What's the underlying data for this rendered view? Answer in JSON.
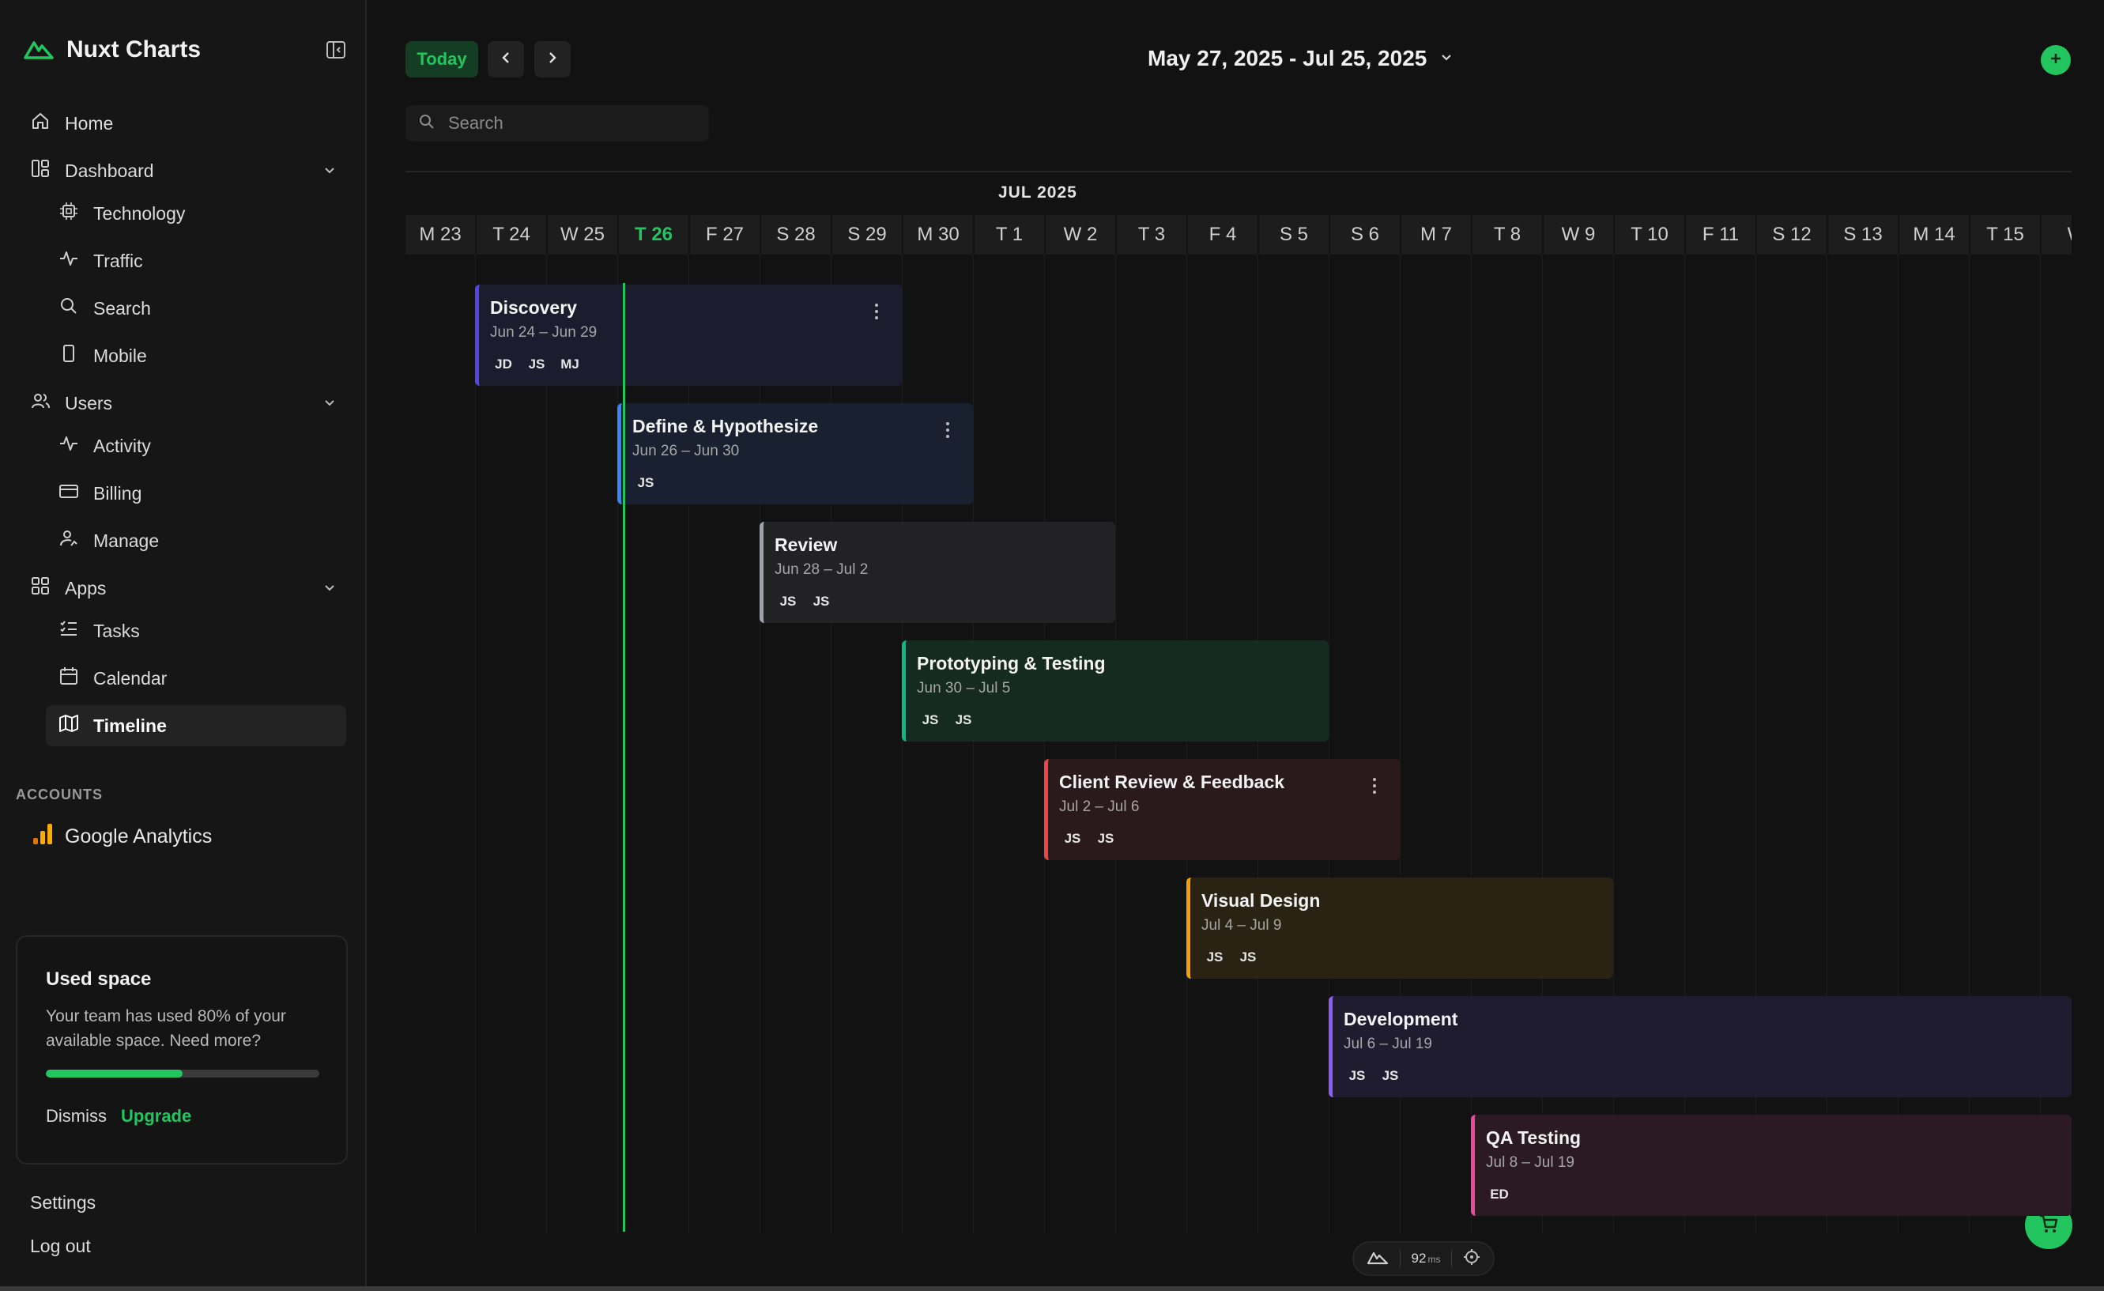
{
  "app": {
    "name": "Nuxt Charts"
  },
  "nav": {
    "home": "Home",
    "dashboard": "Dashboard",
    "technology": "Technology",
    "traffic": "Traffic",
    "search": "Search",
    "mobile": "Mobile",
    "users": "Users",
    "activity": "Activity",
    "billing": "Billing",
    "manage": "Manage",
    "apps": "Apps",
    "tasks": "Tasks",
    "calendar": "Calendar",
    "timeline": "Timeline"
  },
  "accounts": {
    "label": "ACCOUNTS",
    "google_analytics": "Google Analytics"
  },
  "used_space": {
    "title": "Used space",
    "text": "Your team has used 80% of your available space. Need more?",
    "percent": 50,
    "dismiss": "Dismiss",
    "upgrade": "Upgrade"
  },
  "footer": {
    "settings": "Settings",
    "logout": "Log out"
  },
  "toolbar": {
    "today": "Today",
    "date_range": "May 27, 2025 - Jul 25, 2025"
  },
  "search": {
    "placeholder": "Search"
  },
  "timeline": {
    "month_label": "JUL 2025",
    "days": [
      "M 23",
      "T 24",
      "W 25",
      "T 26",
      "F 27",
      "S 28",
      "S 29",
      "M 30",
      "T 1",
      "W 2",
      "T 3",
      "F 4",
      "S 5",
      "S 6",
      "M 7",
      "T 8",
      "W 9",
      "T 10",
      "F 11",
      "S 12",
      "S 13",
      "M 14",
      "T 15",
      "W"
    ],
    "today_index": 3,
    "tasks": [
      {
        "title": "Discovery",
        "dates": "Jun 24 – Jun 29",
        "assignees": [
          "JD",
          "JS",
          "MJ"
        ],
        "color": "#4f46e5",
        "bg": "#1c1c2e",
        "start": 1,
        "span": 6,
        "menu": true
      },
      {
        "title": "Define & Hypothesize",
        "dates": "Jun 26 – Jun 30",
        "assignees": [
          "JS"
        ],
        "color": "#3b82f6",
        "bg": "#19202f",
        "start": 3,
        "span": 5,
        "menu": true
      },
      {
        "title": "Review",
        "dates": "Jun 28 – Jul 2",
        "assignees": [
          "JS",
          "JS"
        ],
        "color": "#9ca3af",
        "bg": "#222224",
        "start": 5,
        "span": 5,
        "menu": false
      },
      {
        "title": "Prototyping & Testing",
        "dates": "Jun 30 – Jul 5",
        "assignees": [
          "JS",
          "JS"
        ],
        "color": "#10b981",
        "bg": "#152a21",
        "start": 7,
        "span": 6,
        "menu": false
      },
      {
        "title": "Client Review & Feedback",
        "dates": "Jul 2 – Jul 6",
        "assignees": [
          "JS",
          "JS"
        ],
        "color": "#ef4444",
        "bg": "#2a1a1b",
        "start": 9,
        "span": 5,
        "menu": true
      },
      {
        "title": "Visual Design",
        "dates": "Jul 4 – Jul 9",
        "assignees": [
          "JS",
          "JS"
        ],
        "color": "#f59e0b",
        "bg": "#2a2314",
        "start": 11,
        "span": 6,
        "menu": false
      },
      {
        "title": "Development",
        "dates": "Jul 6 – Jul 19",
        "assignees": [
          "JS",
          "JS"
        ],
        "color": "#8b5cf6",
        "bg": "#201c30",
        "start": 13,
        "span": 11,
        "menu": false
      },
      {
        "title": "QA Testing",
        "dates": "Jul 8 – Jul 19",
        "assignees": [
          "ED"
        ],
        "color": "#ec4899",
        "bg": "#2b1a24",
        "start": 15,
        "span": 9,
        "menu": false
      }
    ]
  },
  "perf": {
    "value": "92",
    "unit": "ms"
  },
  "colors": {
    "accent": "#22c55e",
    "background": "#121212",
    "sidebar": "#161616"
  },
  "icons": {
    "logo": "nuxt-mountain-icon",
    "collapse": "sidebar-collapse-icon",
    "home": "house-icon",
    "dashboard": "layout-icon",
    "technology": "cpu-icon",
    "traffic": "activity-icon",
    "search": "search-icon",
    "mobile": "smartphone-icon",
    "users": "users-icon",
    "billing": "credit-card-icon",
    "manage": "user-cog-icon",
    "apps": "grid-icon",
    "tasks": "list-checks-icon",
    "calendar": "calendar-icon",
    "timeline": "map-icon",
    "analytics": "bar-chart-icon",
    "add": "plus-icon",
    "cart": "shopping-cart-icon",
    "target": "crosshair-icon"
  }
}
